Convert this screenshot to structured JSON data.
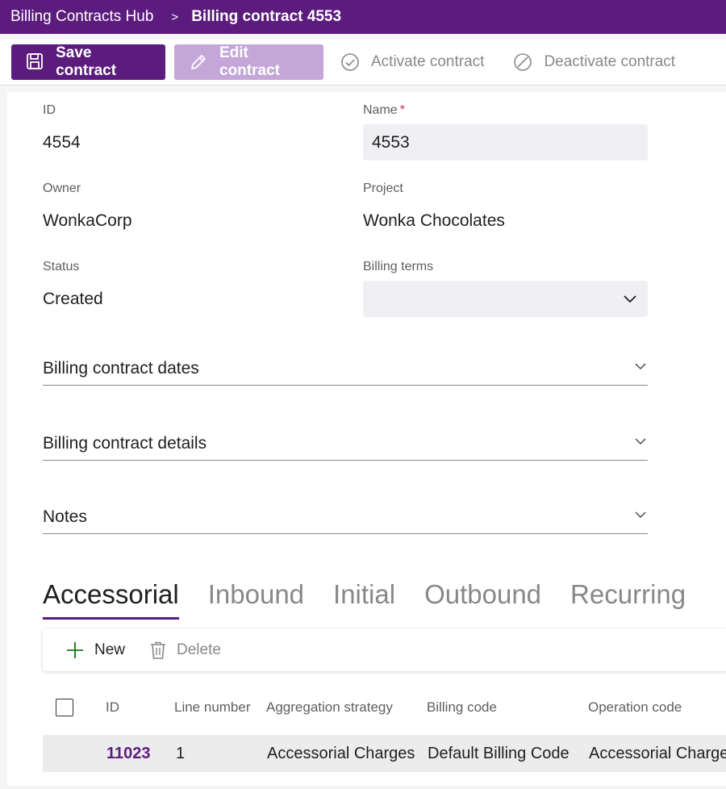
{
  "breadcrumb": {
    "parent": "Billing Contracts Hub",
    "separator": ">",
    "current": "Billing contract 4553"
  },
  "toolbar": {
    "save_label": "Save contract",
    "edit_label": "Edit contract",
    "activate_label": "Activate contract",
    "deactivate_label": "Deactivate contract"
  },
  "form": {
    "id": {
      "label": "ID",
      "value": "4554"
    },
    "name": {
      "label": "Name",
      "required_mark": "*",
      "value": "4553"
    },
    "owner": {
      "label": "Owner",
      "value": "WonkaCorp"
    },
    "project": {
      "label": "Project",
      "value": "Wonka Chocolates"
    },
    "status": {
      "label": "Status",
      "value": "Created"
    },
    "billing_terms": {
      "label": "Billing terms",
      "value": ""
    }
  },
  "sections": [
    {
      "title": "Billing contract dates"
    },
    {
      "title": "Billing contract details"
    },
    {
      "title": "Notes"
    }
  ],
  "tabs": [
    {
      "label": "Accessorial",
      "active": true
    },
    {
      "label": "Inbound",
      "active": false
    },
    {
      "label": "Initial",
      "active": false
    },
    {
      "label": "Outbound",
      "active": false
    },
    {
      "label": "Recurring",
      "active": false
    }
  ],
  "grid": {
    "new_label": "New",
    "delete_label": "Delete",
    "columns": [
      "ID",
      "Line number",
      "Aggregation strategy",
      "Billing code",
      "Operation code"
    ],
    "rows": [
      [
        "11023",
        "1",
        "Accessorial Charges",
        "Default Billing Code",
        "Accessorial Charge"
      ]
    ]
  },
  "colors": {
    "brand": "#5c1c7d",
    "brand_disabled": "#c4a6d8",
    "required": "#c4314b",
    "add_icon": "#107c10"
  },
  "icons": {
    "save": "save-icon",
    "edit": "pencil-icon",
    "activate": "check-circle-icon",
    "deactivate": "block-icon",
    "dropdown": "chevron-down-icon",
    "new": "plus-icon",
    "delete": "trash-icon"
  }
}
